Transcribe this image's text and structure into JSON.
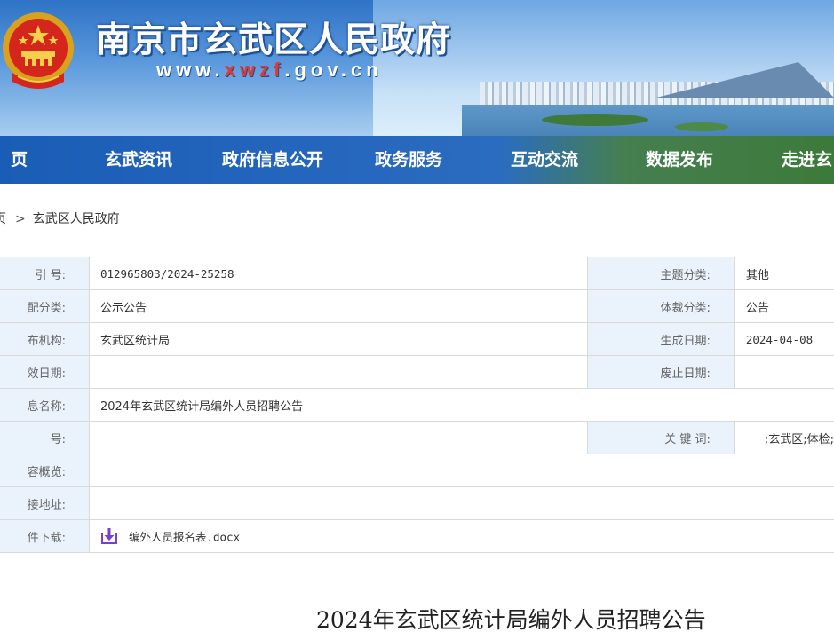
{
  "header": {
    "site_title": "南京市玄武区人民政府",
    "site_url_prefix": "www.",
    "site_url_accent": "xwzf",
    "site_url_suffix": ".gov.cn",
    "emblem_icon": "national-emblem-icon"
  },
  "nav": {
    "items": [
      "页",
      "玄武资讯",
      "政府信息公开",
      "政务服务",
      "互动交流",
      "数据发布",
      "走进玄"
    ]
  },
  "breadcrumb": {
    "home": "页",
    "current": "玄武区人民政府",
    "separator": ">"
  },
  "info_table": {
    "rows": [
      {
        "k1": "引 号:",
        "v1": "012965803/2024-25258",
        "k2": "主题分类:",
        "v2": "其他"
      },
      {
        "k1": "配分类:",
        "v1": "公示公告",
        "k2": "体裁分类:",
        "v2": "公告"
      },
      {
        "k1": "布机构:",
        "v1": "玄武区统计局",
        "k2": "生成日期:",
        "v2": "2024-04-08"
      },
      {
        "k1": "效日期:",
        "v1": "",
        "k2": "废止日期:",
        "v2": ""
      },
      {
        "k1": "息名称:",
        "v1": "2024年玄武区统计局编外人员招聘公告"
      },
      {
        "k1": "号:",
        "v1": "",
        "k2": "关 键 词:",
        "v2": ";玄武区;体检;"
      },
      {
        "k1": "容概览:",
        "v1": ""
      },
      {
        "k1": "接地址:",
        "v1": ""
      },
      {
        "k1": "件下载:",
        "v1": "编外人员报名表.docx"
      }
    ]
  },
  "document": {
    "title": "2024年玄武区统计局编外人员招聘公告"
  },
  "colors": {
    "nav_bg": "#1d5fb8",
    "label_bg": "#eaf2fb",
    "download_icon": "#7b3fd0"
  }
}
